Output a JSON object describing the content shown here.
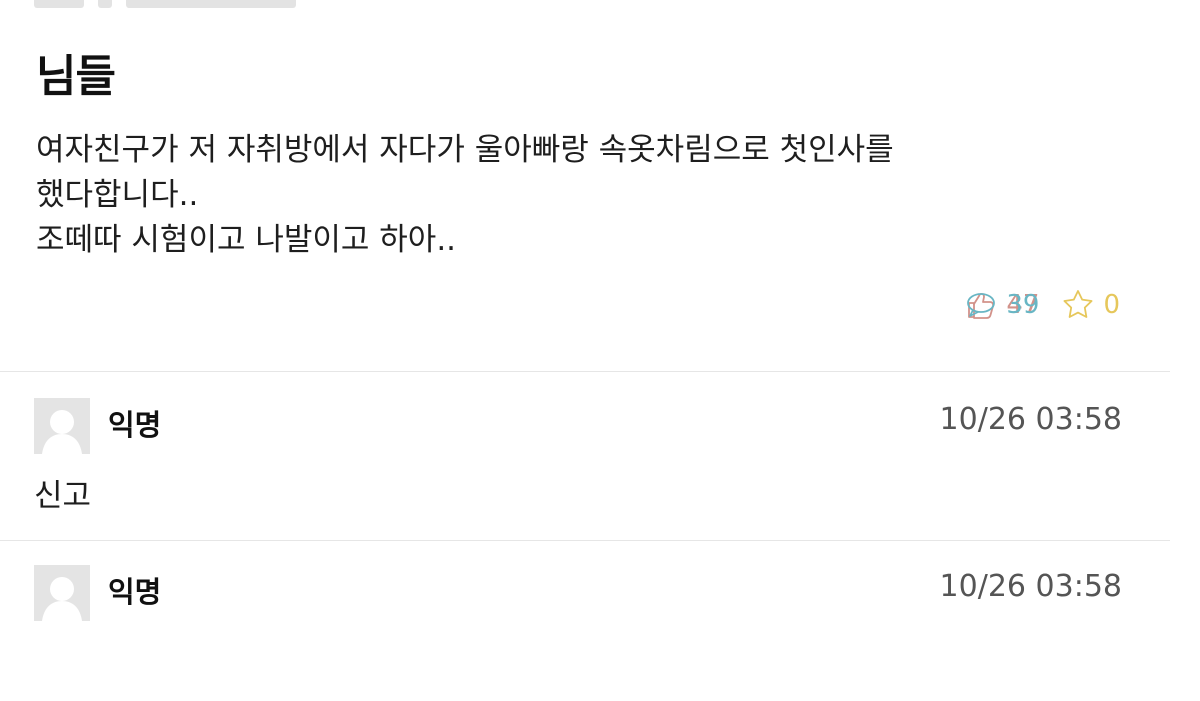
{
  "post": {
    "title": "님들",
    "body_lines": [
      "여자친구가 저 자취방에서 자다가 울아빠랑 속옷차림으로 첫인사를",
      "했다합니다..",
      "조떼따 시험이고 나발이고 하아.."
    ],
    "stats": {
      "likes": "47",
      "comments": "39",
      "scraps": "0",
      "like_color": "#d2928a",
      "comment_color": "#69b6c4",
      "scrap_color": "#e6c75b"
    }
  },
  "comments": [
    {
      "author": "익명",
      "time": "10/26 03:58",
      "text": "신고"
    },
    {
      "author": "익명",
      "time": "10/26 03:58",
      "text": ""
    }
  ],
  "icons": {
    "like": "thumbs-up-icon",
    "comment": "speech-bubble-icon",
    "scrap": "star-icon",
    "avatar": "default-avatar-icon"
  }
}
